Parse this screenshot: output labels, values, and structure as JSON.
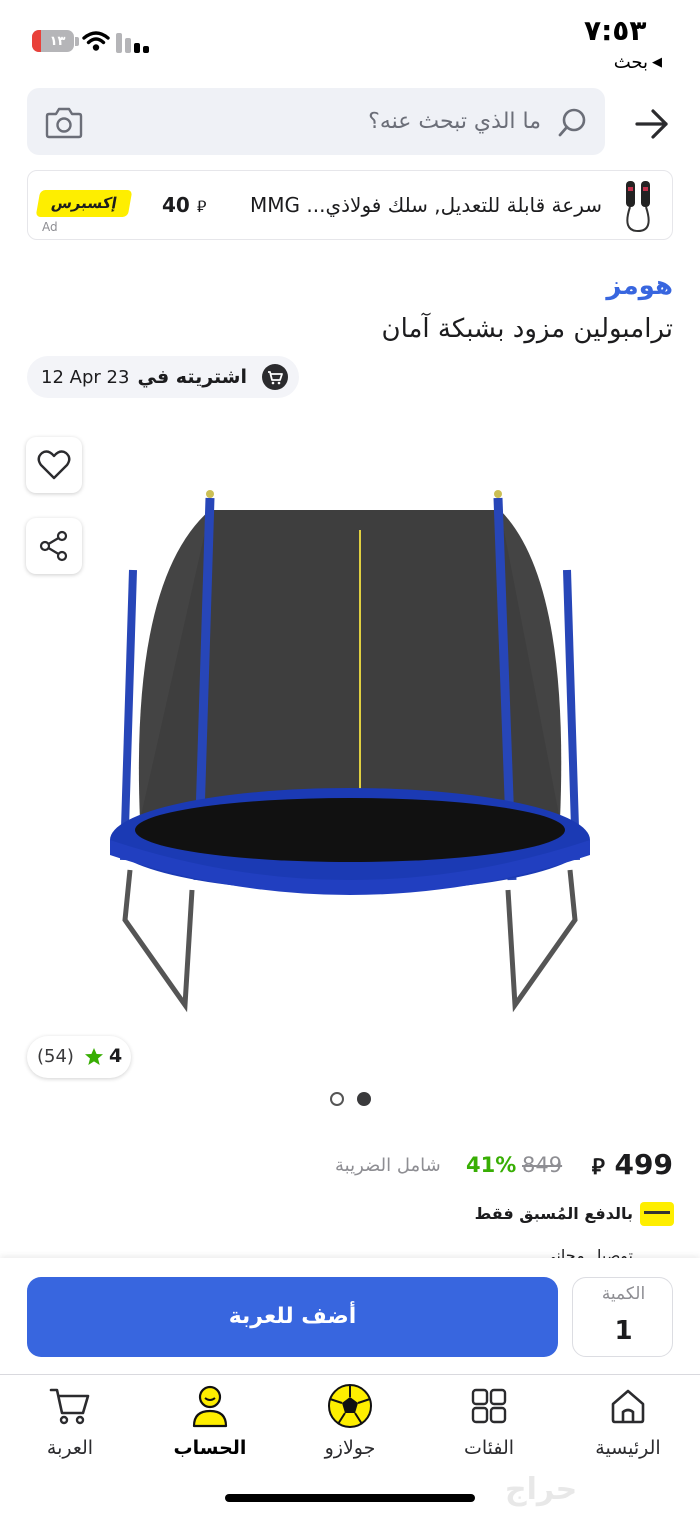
{
  "status_bar": {
    "time": "٧:٥٣",
    "battery": "١٣",
    "back_app": "بحث"
  },
  "search": {
    "placeholder": "ما الذي تبحث عنه؟"
  },
  "ad": {
    "title": "سرعة قابلة للتعديل, سلك فولاذي... MMG",
    "price": "40",
    "currency": "⃁",
    "badge": "إكسبرس",
    "label": "Ad"
  },
  "product": {
    "brand": "هومز",
    "title": "ترامبولين مزود بشبكة آمان",
    "bought_text": "اشتريته في",
    "bought_date": "12 Apr 23",
    "rating": "4",
    "rating_count": "(54)",
    "image_dots": 2,
    "active_dot": 1
  },
  "price": {
    "currency": "⃁",
    "now": "499",
    "old": "849",
    "discount": "41%",
    "tax_note": "شامل الضريبة",
    "prepaid": "بالدفع المُسبق فقط",
    "delivery": "توصيل مجاني"
  },
  "cart_panel": {
    "add_to_cart": "أضف للعربة",
    "quantity_label": "الكمية",
    "quantity_value": "1"
  },
  "tabbar": {
    "home": "الرئيسية",
    "categories": "الفئات",
    "goalazo": "جولازو",
    "account": "الحساب",
    "cart": "العربة",
    "active": "account"
  },
  "watermark": "حراج",
  "colors": {
    "accent_blue": "#3866df",
    "noon_yellow": "#feee00",
    "discount_green": "#38ae04"
  }
}
